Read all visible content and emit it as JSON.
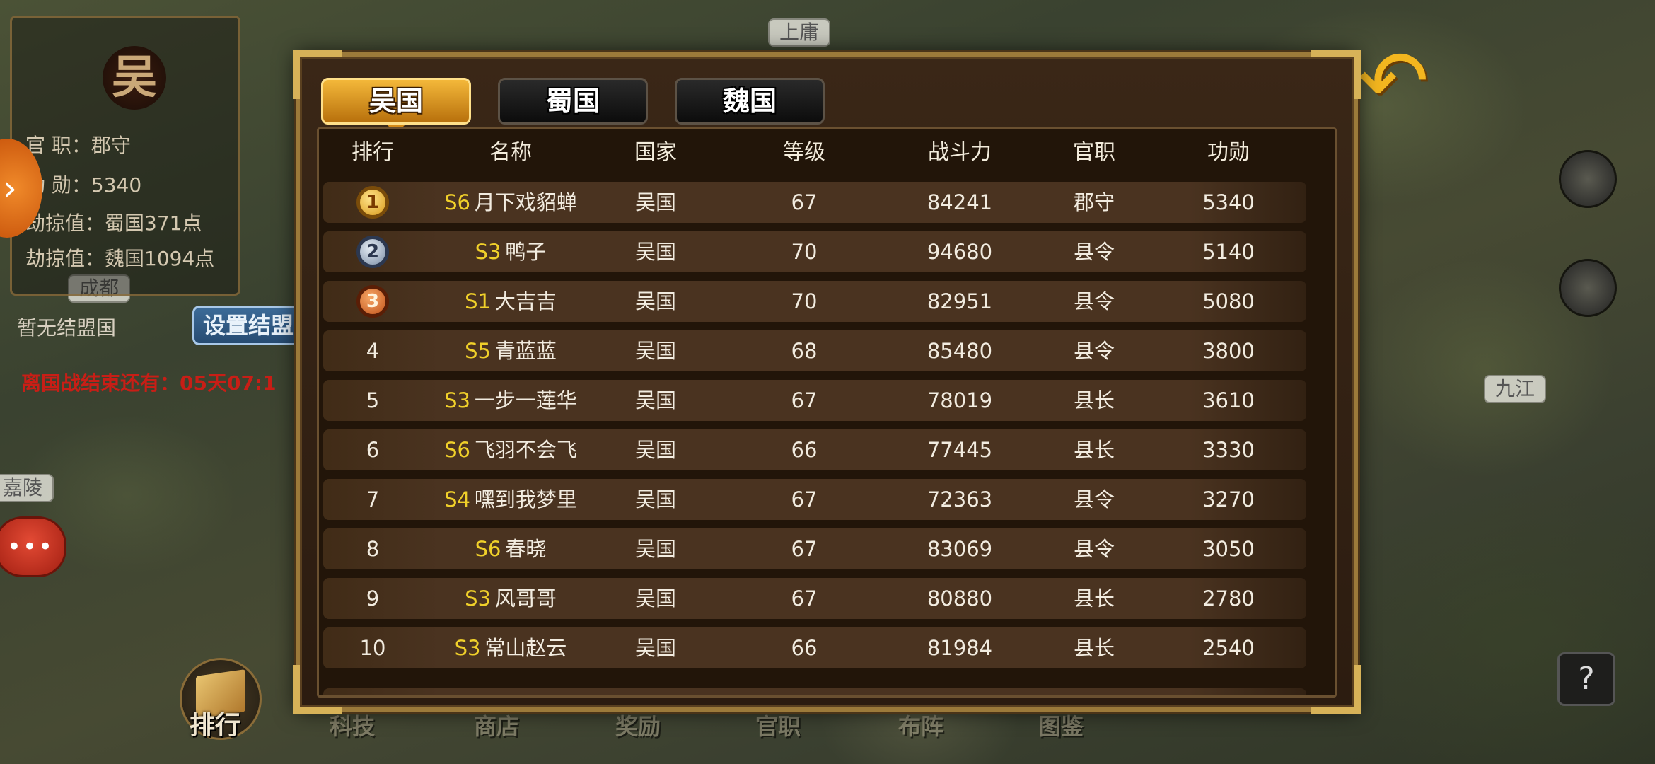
{
  "map": {
    "cities": [
      "上庸",
      "九江",
      "嘉陵",
      "成都"
    ],
    "faction_seal": "吴"
  },
  "player_info": {
    "office": "官  职：郡守",
    "merit": "功  勋：5340",
    "plunder_shu": "劫掠值：蜀国371点",
    "plunder_wei": "劫掠值：魏国1094点",
    "no_alliance": "暂无结盟国",
    "set_alliance_button": "设置结盟",
    "war_timer": "离国战结束还有：05天07:1"
  },
  "bottom_menu": {
    "rank": "排行",
    "items": [
      "科技",
      "商店",
      "奖励",
      "官职",
      "布阵",
      "图鉴"
    ]
  },
  "icons": {
    "chat": "chat-bubble-icon",
    "back": "back-arrow-icon",
    "help": "?"
  },
  "tabs": [
    {
      "label": "吴国",
      "active": true
    },
    {
      "label": "蜀国",
      "active": false
    },
    {
      "label": "魏国",
      "active": false
    }
  ],
  "table": {
    "headers": {
      "rank": "排行",
      "name": "名称",
      "nation": "国家",
      "level": "等级",
      "power": "战斗力",
      "title": "官职",
      "merit": "功勋"
    },
    "rows": [
      {
        "rank": "1",
        "server": "S6",
        "name": "月下戏貂蝉",
        "nation": "吴国",
        "level": "67",
        "power": "84241",
        "title": "郡守",
        "merit": "5340"
      },
      {
        "rank": "2",
        "server": "S3",
        "name": "鸭子",
        "nation": "吴国",
        "level": "70",
        "power": "94680",
        "title": "县令",
        "merit": "5140"
      },
      {
        "rank": "3",
        "server": "S1",
        "name": "大吉吉",
        "nation": "吴国",
        "level": "70",
        "power": "82951",
        "title": "县令",
        "merit": "5080"
      },
      {
        "rank": "4",
        "server": "S5",
        "name": "青蓝蓝",
        "nation": "吴国",
        "level": "68",
        "power": "85480",
        "title": "县令",
        "merit": "3800"
      },
      {
        "rank": "5",
        "server": "S3",
        "name": "一步一莲华",
        "nation": "吴国",
        "level": "67",
        "power": "78019",
        "title": "县长",
        "merit": "3610"
      },
      {
        "rank": "6",
        "server": "S6",
        "name": "飞羽不会飞",
        "nation": "吴国",
        "level": "66",
        "power": "77445",
        "title": "县长",
        "merit": "3330"
      },
      {
        "rank": "7",
        "server": "S4",
        "name": "嘿到我梦里",
        "nation": "吴国",
        "level": "67",
        "power": "72363",
        "title": "县令",
        "merit": "3270"
      },
      {
        "rank": "8",
        "server": "S6",
        "name": "春晓",
        "nation": "吴国",
        "level": "67",
        "power": "83069",
        "title": "县令",
        "merit": "3050"
      },
      {
        "rank": "9",
        "server": "S3",
        "name": "风哥哥",
        "nation": "吴国",
        "level": "67",
        "power": "80880",
        "title": "县长",
        "merit": "2780"
      },
      {
        "rank": "10",
        "server": "S3",
        "name": "常山赵云",
        "nation": "吴国",
        "level": "66",
        "power": "81984",
        "title": "县长",
        "merit": "2540"
      }
    ]
  },
  "colors": {
    "server_tag": "#f0d02a",
    "active_tab": "#f4b83a",
    "frame_gold": "#d7b258"
  }
}
